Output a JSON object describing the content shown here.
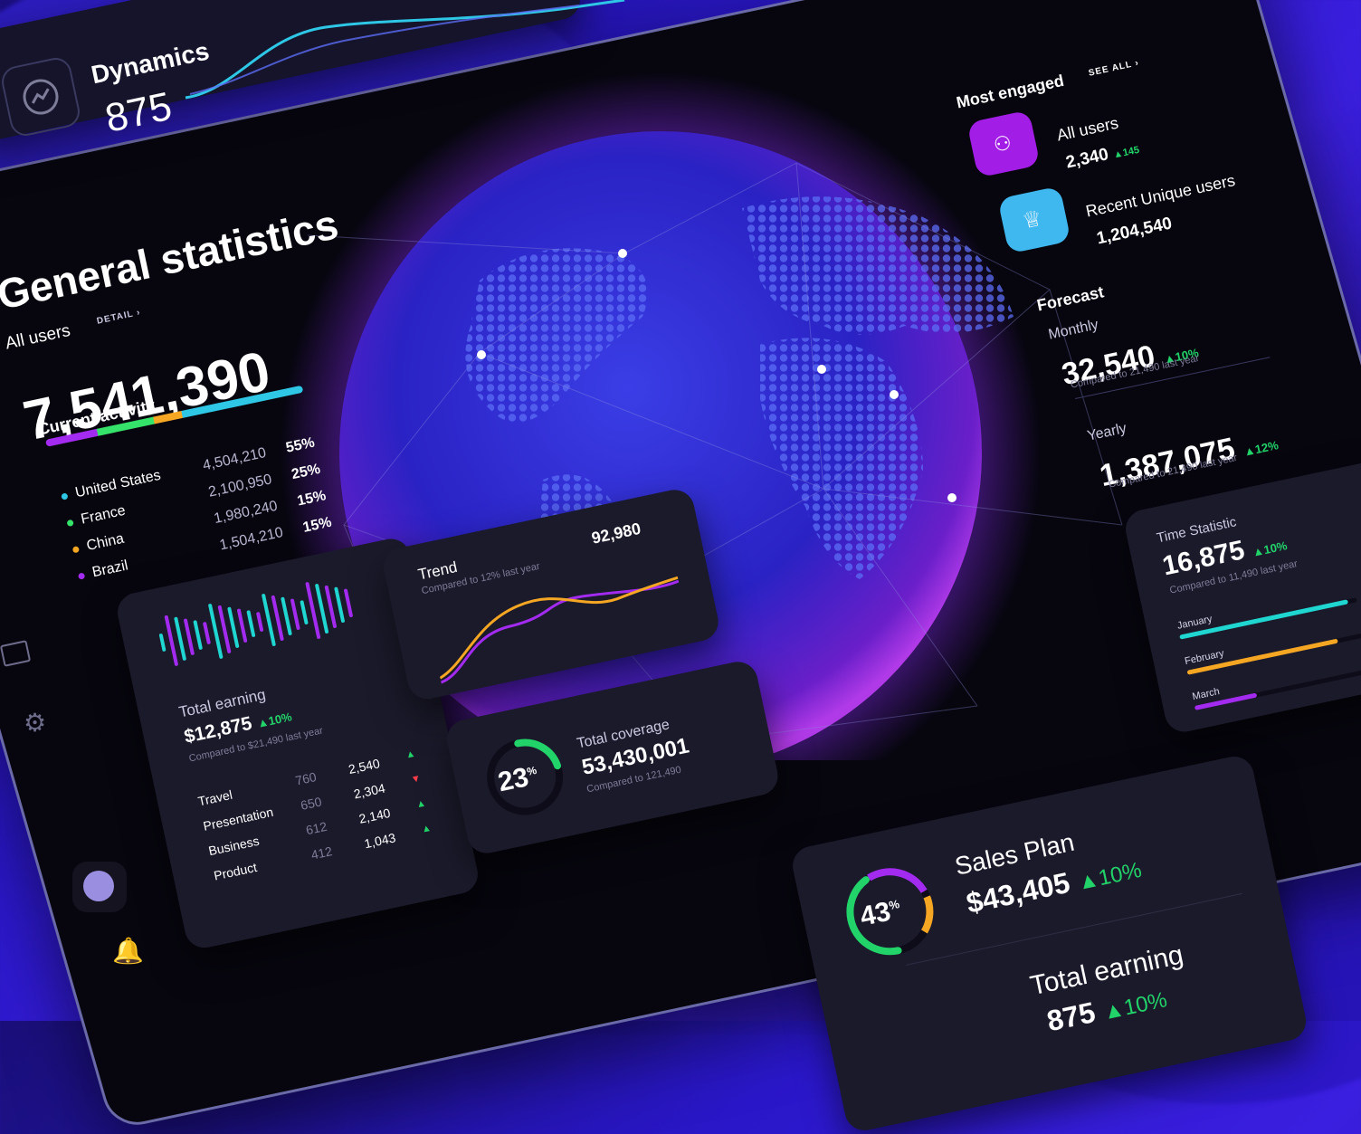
{
  "dynamics": {
    "title": "Dynamics",
    "value": "875"
  },
  "general": {
    "title": "General statistics",
    "all_users_label": "All users",
    "detail_link": "DETAIL",
    "all_users_value": "7,541,390",
    "current_activity_label": "Current activity",
    "countries": [
      {
        "name": "United States",
        "value": "4,504,210",
        "pct": "55%",
        "color": "#2ec7e6"
      },
      {
        "name": "France",
        "value": "2,100,950",
        "pct": "25%",
        "color": "#36e36a"
      },
      {
        "name": "China",
        "value": "1,980,240",
        "pct": "15%",
        "color": "#f5a623"
      },
      {
        "name": "Brazil",
        "value": "1,504,210",
        "pct": "15%",
        "color": "#a32bf0"
      }
    ]
  },
  "earning_card": {
    "title": "Total earning",
    "value": "$12,875",
    "change": "10%",
    "compare": "Compared to $21,490 last year",
    "rows": [
      {
        "name": "Travel",
        "a": "760",
        "b": "2,540",
        "trend": "up"
      },
      {
        "name": "Presentation",
        "a": "650",
        "b": "2,304",
        "trend": "down"
      },
      {
        "name": "Business",
        "a": "612",
        "b": "2,140",
        "trend": "up"
      },
      {
        "name": "Product",
        "a": "412",
        "b": "1,043",
        "trend": "up"
      }
    ]
  },
  "trend_card": {
    "title": "Trend",
    "subtitle": "Compared to 12% last year",
    "value": "92,980"
  },
  "coverage_card": {
    "percent": "23",
    "percent_sign": "%",
    "title": "Total coverage",
    "value": "53,430,001",
    "compare": "Compared to 121,490",
    "progress": 0.23
  },
  "most_engaged": {
    "title": "Most engaged",
    "see_all": "SEE ALL",
    "items": [
      {
        "label": "All users",
        "value": "2,340",
        "delta": "145",
        "icon": "users-icon"
      },
      {
        "label": "Recent Unique users",
        "value": "1,204,540",
        "icon": "crown-icon"
      }
    ]
  },
  "forecast": {
    "title": "Forecast",
    "monthly_label": "Monthly",
    "monthly_value": "32,540",
    "monthly_change": "10%",
    "monthly_compare": "Compared to 21,490 last year",
    "yearly_label": "Yearly",
    "yearly_value": "1,387,075",
    "yearly_change": "12%",
    "yearly_compare": "Compared to 21,490 last year"
  },
  "time_card": {
    "title": "Time Statistic",
    "value": "16,875",
    "change": "10%",
    "compare": "Compared to 11,490 last year",
    "bars": [
      {
        "label": "January",
        "fill": 0.95,
        "color": "#1fd6d0"
      },
      {
        "label": "February",
        "fill": 0.85,
        "color": "#f5a623"
      },
      {
        "label": "March",
        "fill": 0.35,
        "color": "#a32bf0"
      }
    ]
  },
  "sales_card": {
    "title": "Sales Plan",
    "value": "$43,405",
    "change": "10%",
    "percent": "43",
    "percent_sign": "%",
    "progress": 0.43,
    "earning_title": "Total earning",
    "earning_value_partial": "875",
    "earning_change": "10%"
  },
  "colors": {
    "accent_purple": "#a32bf0",
    "accent_cyan": "#2ec7e6",
    "green": "#22d36a",
    "orange": "#f5a623"
  }
}
